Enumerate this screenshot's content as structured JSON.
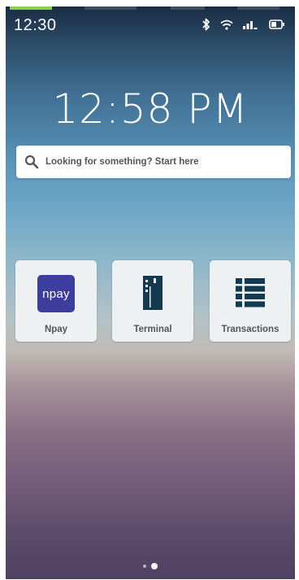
{
  "status_bar": {
    "time": "12:30"
  },
  "lock_clock": {
    "time": "12:58 PM"
  },
  "search": {
    "placeholder": "Looking for something? Start here"
  },
  "apps": [
    {
      "label": "Npay",
      "icon": "npay-logo-icon",
      "logo_text": "npay",
      "color": "#3c3d9c"
    },
    {
      "label": "Terminal",
      "icon": "terminal-icon",
      "color": "#143a4f"
    },
    {
      "label": "Transactions",
      "icon": "list-icon",
      "color": "#143a4f"
    }
  ],
  "pager": {
    "pages": 2,
    "current": 2
  }
}
